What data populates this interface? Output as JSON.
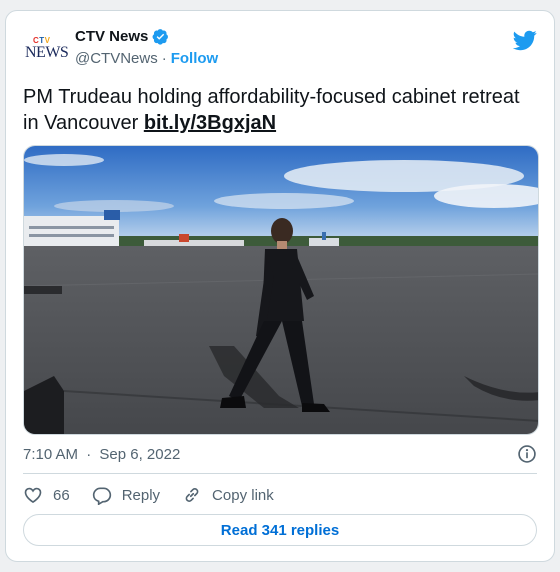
{
  "author": {
    "logo_text": "NEWS",
    "logo_ctv": "CTV",
    "display_name": "CTV News",
    "handle": "@CTVNews",
    "separator": "·",
    "follow_label": "Follow"
  },
  "tweet": {
    "text": "PM Trudeau holding affordability-focused cabinet retreat in Vancouver ",
    "link": "bit.ly/3BgxjaN",
    "time": "7:10 AM",
    "date_separator": "·",
    "date": "Sep 6, 2022"
  },
  "actions": {
    "like_count": "66",
    "reply_label": "Reply",
    "copy_label": "Copy link"
  },
  "footer": {
    "read_replies_label": "Read 341 replies"
  },
  "colors": {
    "accent": "#1d9bf0",
    "link_blue": "#006fd6",
    "secondary_text": "#536471",
    "border": "#cfd9de"
  },
  "icons": [
    "verified-badge-icon",
    "twitter-bird-icon",
    "info-icon",
    "heart-icon",
    "reply-bubble-icon",
    "link-icon"
  ]
}
